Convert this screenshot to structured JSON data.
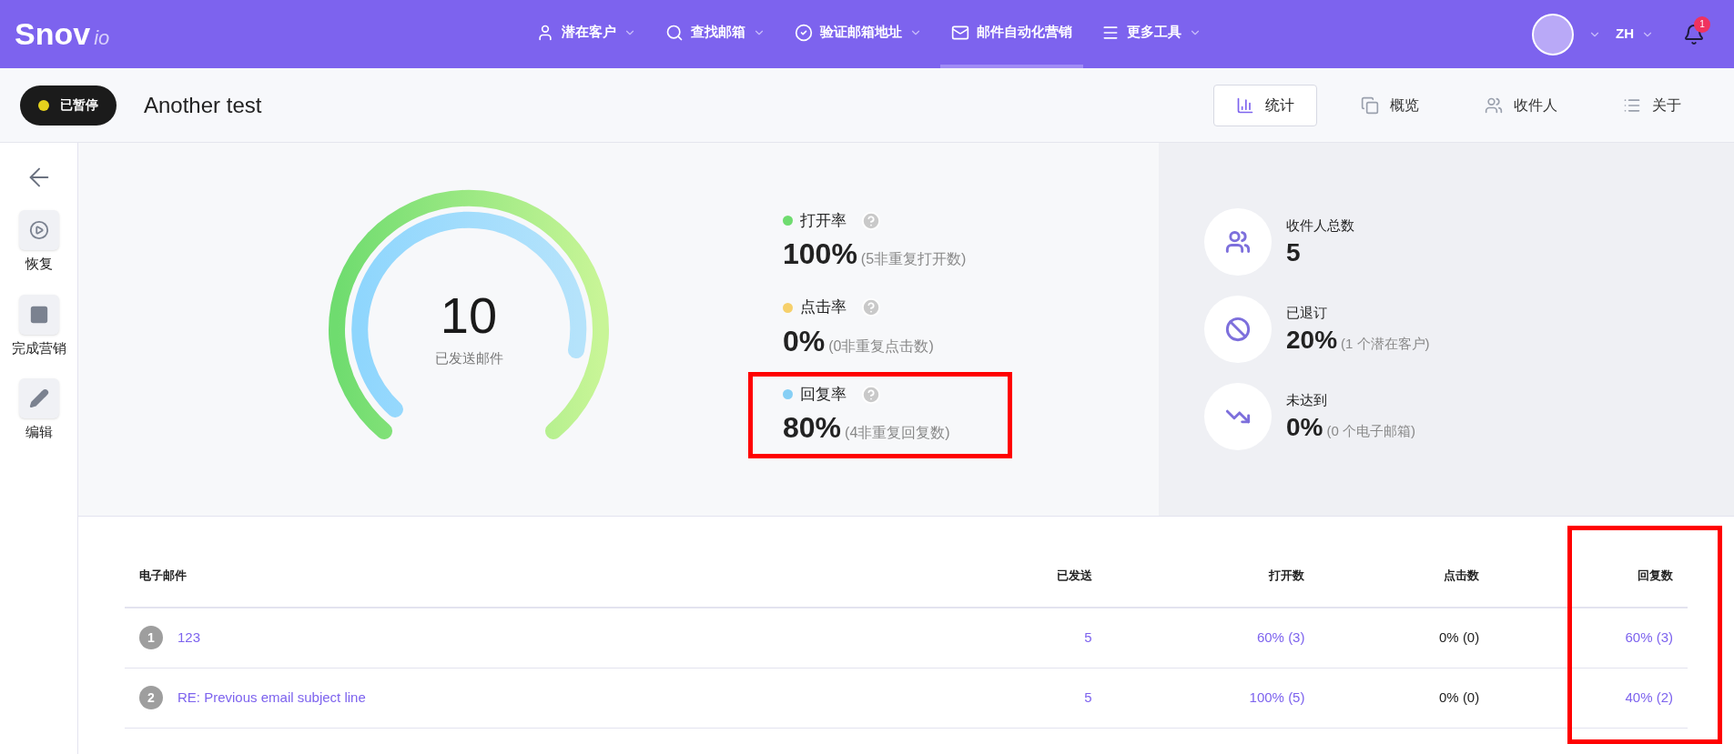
{
  "topbar": {
    "logo": "Snov",
    "logo_suffix": "io",
    "nav": [
      {
        "label": "潜在客户",
        "dropdown": true,
        "selected": false
      },
      {
        "label": "查找邮箱",
        "dropdown": true,
        "selected": false
      },
      {
        "label": "验证邮箱地址",
        "dropdown": true,
        "selected": false
      },
      {
        "label": "邮件自动化营销",
        "dropdown": false,
        "selected": true
      },
      {
        "label": "更多工具",
        "dropdown": true,
        "selected": false
      }
    ],
    "language": "ZH",
    "notification_count": "1"
  },
  "campaign": {
    "status": "已暂停",
    "title": "Another test",
    "tabs": [
      {
        "label": "统计",
        "selected": true
      },
      {
        "label": "概览",
        "selected": false
      },
      {
        "label": "收件人",
        "selected": false
      },
      {
        "label": "关于",
        "selected": false
      }
    ]
  },
  "sidebar": {
    "actions": [
      {
        "label": "恢复"
      },
      {
        "label": "完成营销"
      },
      {
        "label": "编辑"
      }
    ]
  },
  "gauge": {
    "value": "10",
    "label": "已发送邮件"
  },
  "metrics": [
    {
      "label": "打开率",
      "color": "#6fdc6f",
      "value": "100%",
      "detail": "(5非重复打开数)",
      "highlighted": false
    },
    {
      "label": "点击率",
      "color": "#f6d06b",
      "value": "0%",
      "detail": "(0非重复点击数)",
      "highlighted": false
    },
    {
      "label": "回复率",
      "color": "#86cff5",
      "value": "80%",
      "detail": "(4非重复回复数)",
      "highlighted": true
    }
  ],
  "summary": [
    {
      "label": "收件人总数",
      "value": "5"
    },
    {
      "label": "已退订",
      "value": "20%",
      "detail": "(1 个潜在客户)"
    },
    {
      "label": "未达到",
      "value": "0%",
      "detail": "(0 个电子邮箱)"
    }
  ],
  "table": {
    "columns": [
      {
        "label": "电子邮件",
        "highlighted": false
      },
      {
        "label": "已发送",
        "highlighted": false
      },
      {
        "label": "打开数",
        "highlighted": false
      },
      {
        "label": "点击数",
        "highlighted": false
      },
      {
        "label": "回复数",
        "highlighted": true
      }
    ],
    "rows": [
      {
        "index": "1",
        "subject": "123",
        "sent": "5",
        "opens": "60% (3)",
        "clicks": "0% (0)",
        "replies": "60% (3)"
      },
      {
        "index": "2",
        "subject": "RE: Previous email subject line",
        "sent": "5",
        "opens": "100% (5)",
        "clicks": "0% (0)",
        "replies": "40% (2)"
      }
    ]
  }
}
